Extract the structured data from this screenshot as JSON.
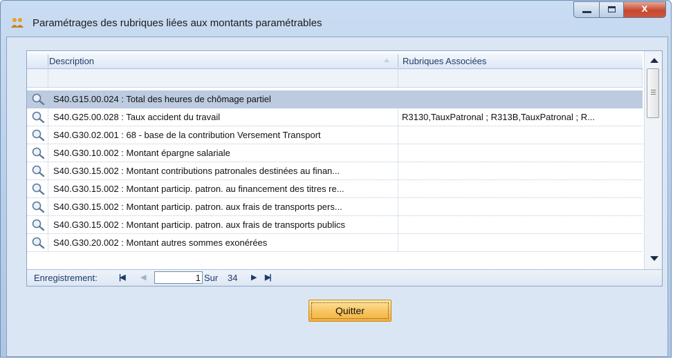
{
  "window": {
    "title": "Paramétrages des rubriques liées aux montants paramétrables",
    "close_glyph": "x"
  },
  "grid": {
    "columns": [
      "Description",
      "Rubriques Associées"
    ],
    "rows": [
      {
        "description": "S40.G15.00.024 : Total des heures de chômage partiel",
        "rubriques": "",
        "selected": true
      },
      {
        "description": "S40.G25.00.028 : Taux accident du travail",
        "rubriques": "R3130,TauxPatronal ; R313B,TauxPatronal ; R..."
      },
      {
        "description": "S40.G30.02.001 : 68 - base de la contribution Versement Transport",
        "rubriques": ""
      },
      {
        "description": "S40.G30.10.002 : Montant épargne salariale",
        "rubriques": ""
      },
      {
        "description": "S40.G30.15.002 : Montant contributions patronales destinées au finan...",
        "rubriques": ""
      },
      {
        "description": "S40.G30.15.002 : Montant particip. patron. au financement des titres re...",
        "rubriques": ""
      },
      {
        "description": "S40.G30.15.002 : Montant particip. patron. aux frais de transports pers...",
        "rubriques": ""
      },
      {
        "description": "S40.G30.15.002 : Montant particip. patron. aux frais de transports publics",
        "rubriques": ""
      },
      {
        "description": "S40.G30.20.002 : Montant autres sommes exonérées",
        "rubriques": ""
      }
    ]
  },
  "navigator": {
    "label": "Enregistrement:",
    "current_page": "1",
    "of_label": "Sur",
    "total": "34"
  },
  "buttons": {
    "quit_label": "Quitter"
  },
  "colors": {
    "selected_row": "#bccbe0",
    "button_accent": "#f8c766",
    "window_frame": "#b7cde8"
  }
}
